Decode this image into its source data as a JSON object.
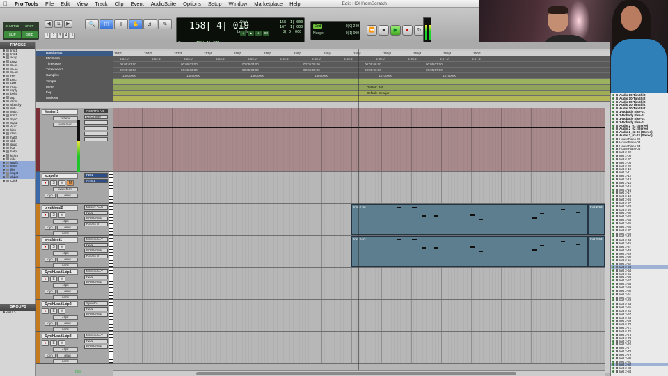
{
  "menubar": {
    "app": "Pro Tools",
    "items": [
      "File",
      "Edit",
      "View",
      "Track",
      "Clip",
      "Event",
      "AudioSuite",
      "Options",
      "Setup",
      "Window",
      "Marketplace",
      "Help"
    ],
    "window_title": "Edit: HOHfromScratch"
  },
  "toolbar": {
    "modes": [
      "SHUFFLE",
      "SPOT",
      "SLIP",
      "GRID"
    ],
    "active_modes": [
      "SLIP",
      "GRID"
    ],
    "zoom_presets": [
      "1",
      "2",
      "3",
      "4",
      "5"
    ],
    "main_counter": "158| 4| 019",
    "start_label": "Start",
    "start_value": "158| 1| 000",
    "end_label": "End",
    "end_value": "167| 1| 000",
    "length_label": "Length",
    "length_value": "8| 0| 000",
    "cursor_label": "Cursor",
    "cursor_value": "158| 1| 077",
    "grid_label": "Grid",
    "grid_value": "0| 0| 240",
    "nudge_label": "Nudge",
    "nudge_value": "0| 1| 000",
    "tempo_readout": "80",
    "transport_icons": [
      "rewind-icon",
      "stop-icon",
      "play-icon",
      "record-icon",
      "loop-icon"
    ]
  },
  "left_panel": {
    "header": "TRACKS",
    "tracks": [
      "Inst1",
      "Inst1",
      "acap",
      "phr2",
      "SL11",
      "SL12",
      "SL13",
      "HiP",
      "pmc",
      "HP1",
      "Aux1",
      "reply",
      "bells",
      "arp",
      "dron",
      "sketchy",
      "sub",
      "MID1",
      "Inst2",
      "Syn2",
      "Syn2",
      "Aux1",
      "kick",
      "clap",
      "hat3",
      "shft",
      "snap",
      "hat",
      "hatp",
      "kshm",
      "ride",
      "sndfx",
      "808s",
      "fills",
      "impct",
      "shker",
      "Click"
    ],
    "selected": [
      31,
      32,
      33,
      34,
      35
    ],
    "groups_header": "GROUPS",
    "groups_all": "<ALL>"
  },
  "rulers": {
    "bars_label": "Bars|Beats",
    "bars_ticks": [
      "157|1",
      "157|2",
      "157|3",
      "157|4",
      "158|1",
      "158|2",
      "158|3",
      "158|4",
      "159|1",
      "159|2",
      "159|3",
      "159|4",
      "160|1"
    ],
    "minsecs_label": "Min:Secs",
    "minsecs_ticks": [
      "5:02.0",
      "5:02.5",
      "5:03.0",
      "5:03.5",
      "5:04.0",
      "5:04.5",
      "5:05.0",
      "5:05.5",
      "5:06.0",
      "5:06.5",
      "5:07.0",
      "5:07.5"
    ],
    "tc_label": "Timecode",
    "tc_ticks": [
      "00:05:02:00",
      "00:05:03:00",
      "00:05:04:00",
      "00:05:05:00",
      "00:05:06:00",
      "00:05:07:00"
    ],
    "tc2_label": "Timecode 2",
    "tc2_ticks": [
      "00:05:02:00",
      "00:05:03:00",
      "00:05:04:00",
      "00:05:05:00",
      "00:05:06:00",
      "00:05:07:00"
    ],
    "samples_label": "Samples",
    "samples_ticks": [
      "14500000",
      "14550000",
      "14600000",
      "14650000",
      "14700000",
      "14750000"
    ],
    "tempo_label": "Tempo",
    "meter_label": "Meter",
    "meter_value": "Default: 4/4",
    "key_label": "Key",
    "key_value": "Default: C major",
    "markers_label": "Markers"
  },
  "tracks": [
    {
      "name": "Master 1",
      "view": "volume",
      "auto": "auto read",
      "inserts_header": "INSERTS A-E",
      "inserts": [
        "iZoOzone7"
      ]
    },
    {
      "name": "acapella",
      "view": "waveform",
      "mode": "dyn",
      "read": "read",
      "inserts": [
        "F202",
        "AT 8.1"
      ]
    },
    {
      "name": "breakload2",
      "view": "clips",
      "mode": "dyn",
      "read": "read",
      "none": "none",
      "inserts": [
        "Massiv-AAX",
        "F202",
        "BCPitchWk",
        "ReVibe II"
      ],
      "clip": "Inst 2-53"
    },
    {
      "name": "breaktest1",
      "view": "clips",
      "mode": "dyn",
      "read": "read",
      "none": "none",
      "inserts": [
        "Massiv-AAX",
        "F202",
        "BCPitchWk",
        "ReVibe II"
      ],
      "clip": "Inst 2-53"
    },
    {
      "name": "SynthLead1.dp1",
      "view": "clips",
      "mode": "dyn",
      "read": "read",
      "none": "none",
      "inserts": [
        "Massiv-AAX",
        "F202",
        "BCPitchWk"
      ]
    },
    {
      "name": "SynthLead1.dp2",
      "view": "clips",
      "mode": "dyn",
      "read": "read",
      "none": "none",
      "inserts": [
        "Sylenth1",
        "F202",
        "BCPitchWk"
      ]
    },
    {
      "name": "SynthLead1.dp3",
      "view": "clips",
      "mode": "dyn",
      "read": "read",
      "none": "none",
      "inserts": [
        "Massiv-AAX",
        "F202",
        "BCPitchWk"
      ]
    }
  ],
  "status": {
    "play": "play"
  },
  "clip_list": {
    "items": [
      "Audio 10-TimShift",
      "Audio 10-TimShift",
      "Audio 10-TimShift",
      "Audio 10-TimShift",
      "Audio 10-TimShift",
      "1-Nobody Else-01",
      "1-Nobody Else-01",
      "1-Nobody Else-01",
      "1-Nobody Else-01",
      "Audio 2_01 (Stereo)",
      "Audio 2_02 (Stereo)",
      "Audio 2_02-03 (Stereo)",
      "Audio 2_02-03 (Stereo)",
      "HousePiano-02",
      "HousePiano-03",
      "HousePiano-04",
      "HousePiano-05",
      "Inst 2-02",
      "Inst 2-06",
      "Inst 2-07",
      "Inst 2-08",
      "Inst 2-09",
      "Inst 2-10",
      "Inst 2-11",
      "Inst 2-12",
      "Inst 2-13",
      "Inst 2-14",
      "Inst 2-15",
      "Inst 2-16",
      "Inst 2-17",
      "Inst 2-18",
      "Inst 2-26",
      "Inst 2-27",
      "Inst 2-28",
      "Inst 2-29",
      "Inst 2-30",
      "Inst 2-32",
      "Inst 2-34",
      "Inst 2-35",
      "Inst 2-36",
      "Inst 2-37",
      "Inst 2-38",
      "Inst 2-42",
      "Inst 2-44",
      "Inst 2-45",
      "Inst 2-47",
      "Inst 2-48",
      "Inst 2-49",
      "Inst 2-50",
      "Inst 2-51",
      "Inst 2-52",
      "Inst 2-53",
      "Inst 2-54",
      "Inst 2-55",
      "Inst 2-56",
      "Inst 2-57",
      "Inst 2-58",
      "Inst 2-59",
      "Inst 2-60",
      "Inst 2-61",
      "Inst 2-62",
      "Inst 2-63",
      "Inst 2-64",
      "Inst 2-65",
      "Inst 2-66",
      "Inst 2-67",
      "Inst 2-68",
      "Inst 2-69",
      "Inst 2-70",
      "Inst 2-71",
      "Inst 2-72",
      "Inst 2-73",
      "Inst 2-74",
      "Inst 2-75",
      "Inst 2-76",
      "Inst 2-77",
      "Inst 2-78",
      "Inst 2-79",
      "Inst 2-80",
      "Inst 2-81",
      "Inst 2-82",
      "Inst 2-83",
      "Inst 2-84"
    ],
    "selected": [
      51,
      80
    ]
  }
}
